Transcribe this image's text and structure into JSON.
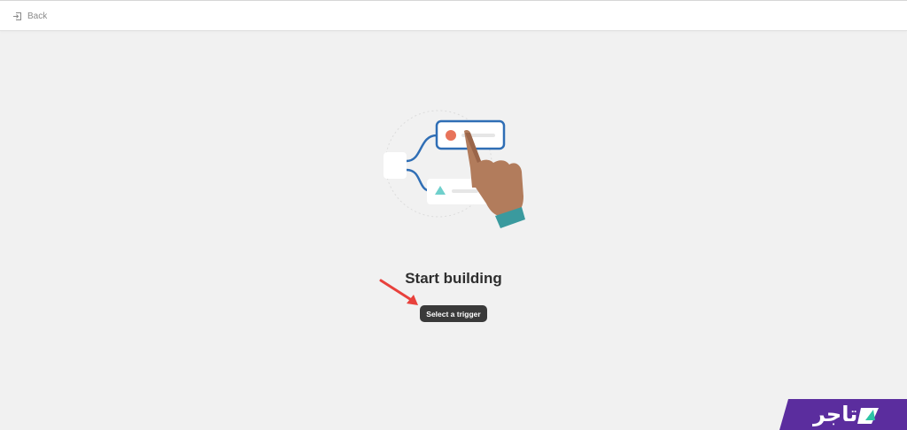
{
  "topbar": {
    "back_label": "Back",
    "back_icon": "exit-door-icon"
  },
  "main": {
    "heading": "Start building",
    "trigger_button_label": "Select a trigger",
    "illustration_icon": "workflow-hand-illustration"
  },
  "annotation": {
    "arrow_icon": "red-arrow-icon",
    "arrow_color": "#e8413c"
  },
  "brand": {
    "name": "تاجر",
    "background_color": "#5b2d9e",
    "accent_color": "#2ec4a6",
    "logo_icon": "tajer-logo-icon"
  },
  "colors": {
    "page_background": "#f1f1f1",
    "button_background": "#3a3a3a",
    "node_border": "#2f6eb5"
  }
}
